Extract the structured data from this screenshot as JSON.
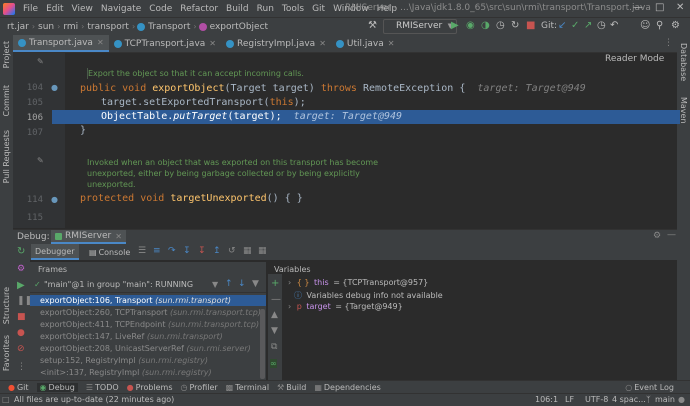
{
  "menu": {
    "items": [
      "File",
      "Edit",
      "View",
      "Navigate",
      "Code",
      "Refactor",
      "Build",
      "Run",
      "Tools",
      "Git",
      "Window",
      "Help"
    ],
    "window_title": "RMIServer - ...\\Java\\jdk1.8.0_65\\src\\sun\\rmi\\transport\\Transport.java"
  },
  "nav": {
    "crumbs": [
      "rt.jar",
      "sun",
      "rmi",
      "transport",
      "Transport",
      "exportObject"
    ],
    "run_config": "RMIServer",
    "git_label": "Git:"
  },
  "tabs": [
    {
      "label": "Transport.java",
      "active": true
    },
    {
      "label": "TCPTransport.java",
      "active": false
    },
    {
      "label": "RegistryImpl.java",
      "active": false
    },
    {
      "label": "Util.java",
      "active": false
    }
  ],
  "left_strip": {
    "project": "Project",
    "commit": "Commit",
    "pull_requests": "Pull Requests",
    "structure": "Structure",
    "favorites": "Favorites"
  },
  "right_strip": {
    "database": "Database",
    "maven": "Maven"
  },
  "editor": {
    "reader_mode": "Reader Mode",
    "doc1": "Export the object so that it can accept incoming calls.",
    "line104": "104",
    "line105": "105",
    "line106": "106",
    "line107": "107",
    "line114": "114",
    "line115": "115",
    "code104_kw1": "public void ",
    "code104_fn": "exportObject",
    "code104_rest": "(Target target) ",
    "code104_kw2": "throws ",
    "code104_end": "RemoteException {",
    "code104_hint": "target: Target@949",
    "code105_a": "target.setExportedTransport(",
    "code105_kw": "this",
    "code105_b": ");",
    "code106_a": "ObjectTable.",
    "code106_it": "putTarget",
    "code106_b": "(target);",
    "code106_hint": "target: Target@949",
    "code107": "}",
    "doc2_l1": "Invoked when an object that was exported on this transport has become",
    "doc2_l2": "unexported, either by being garbage collected or by being explicitly",
    "doc2_l3": "unexported.",
    "code114_kw": "protected void ",
    "code114_fn": "targetUnexported",
    "code114_rest": "() { }"
  },
  "debug": {
    "label": "Debug:",
    "session": "RMIServer",
    "tab_debugger": "Debugger",
    "tab_console": "Console",
    "frames_title": "Frames",
    "variables_title": "Variables",
    "thread": "\"main\"@1 in group \"main\": RUNNING",
    "frames": [
      {
        "method": "exportObject:106, Transport",
        "pkg": "(sun.rmi.transport)",
        "selected": true
      },
      {
        "method": "exportObject:260, TCPTransport",
        "pkg": "(sun.rmi.transport.tcp)",
        "selected": false
      },
      {
        "method": "exportObject:411, TCPEndpoint",
        "pkg": "(sun.rmi.transport.tcp)",
        "selected": false
      },
      {
        "method": "exportObject:147, LiveRef",
        "pkg": "(sun.rmi.transport)",
        "selected": false
      },
      {
        "method": "exportObject:208, UnicastServerRef",
        "pkg": "(sun.rmi.server)",
        "selected": false
      },
      {
        "method": "setup:152, RegistryImpl",
        "pkg": "(sun.rmi.registry)",
        "selected": false
      },
      {
        "method": "<init>:137, RegistryImpl",
        "pkg": "(sun.rmi.registry)",
        "selected": false
      }
    ],
    "vars": [
      {
        "name": "this",
        "value": "= {TCPTransport@957}",
        "kind": "object"
      },
      {
        "name": "",
        "value": "Variables debug info not available",
        "kind": "info"
      },
      {
        "name": "target",
        "value": "= {Target@949}",
        "kind": "param"
      }
    ]
  },
  "toolwindows": [
    "Git",
    "Debug",
    "TODO",
    "Problems",
    "Profiler",
    "Terminal",
    "Build",
    "Dependencies"
  ],
  "event_log": "Event Log",
  "status": {
    "message": "All files are up-to-date (22 minutes ago)",
    "position": "106:1",
    "line_sep": "LF",
    "encoding": "UTF-8",
    "indent": "4 spac...",
    "branch": "main"
  },
  "colors": {
    "accent": "#2d5b96",
    "keyword": "#cc7832",
    "function": "#ffc66d",
    "doc": "#629755"
  }
}
